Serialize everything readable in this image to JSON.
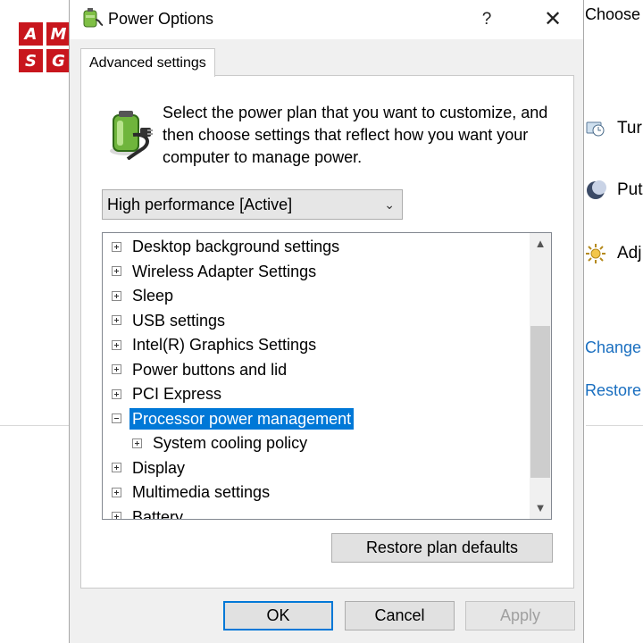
{
  "logo": {
    "letters": [
      "A",
      "M",
      "S",
      "G"
    ],
    "color": "#c8161d"
  },
  "background_window": {
    "title": "Choose",
    "rows": [
      {
        "label": "Turr",
        "icon": "monitor-clock-icon"
      },
      {
        "label": "Put",
        "icon": "moon-icon"
      },
      {
        "label": "Adj",
        "icon": "brightness-icon"
      }
    ],
    "links": [
      "Change",
      "Restore"
    ],
    "link_color": "#1a6fc0"
  },
  "dialog": {
    "title": "Power Options",
    "help": "?",
    "close": "✕",
    "tab": "Advanced settings",
    "intro": "Select the power plan that you want to customize, and then choose settings that reflect how you want your computer to manage power.",
    "plan_select": {
      "value": "High performance [Active]"
    },
    "tree": {
      "items": [
        {
          "label": "Desktop background settings",
          "expander": "plus",
          "level": 0
        },
        {
          "label": "Wireless Adapter Settings",
          "expander": "plus",
          "level": 0
        },
        {
          "label": "Sleep",
          "expander": "plus",
          "level": 0
        },
        {
          "label": "USB settings",
          "expander": "plus",
          "level": 0
        },
        {
          "label": "Intel(R) Graphics Settings",
          "expander": "plus",
          "level": 0
        },
        {
          "label": "Power buttons and lid",
          "expander": "plus",
          "level": 0
        },
        {
          "label": "PCI Express",
          "expander": "plus",
          "level": 0
        },
        {
          "label": "Processor power management",
          "expander": "minus",
          "level": 0,
          "selected": true
        },
        {
          "label": "System cooling policy",
          "expander": "plus",
          "level": 1
        },
        {
          "label": "Display",
          "expander": "plus",
          "level": 0
        },
        {
          "label": "Multimedia settings",
          "expander": "plus",
          "level": 0
        },
        {
          "label": "Battery",
          "expander": "plus",
          "level": 0
        }
      ],
      "selection_color": "#0078d7"
    },
    "restore_button": "Restore plan defaults",
    "buttons": {
      "ok": "OK",
      "cancel": "Cancel",
      "apply": "Apply"
    }
  }
}
